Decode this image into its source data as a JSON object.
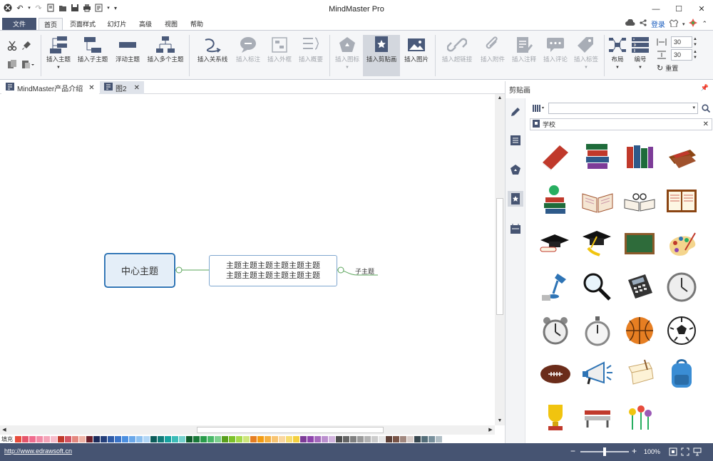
{
  "window": {
    "title": "MindMaster Pro"
  },
  "titlebar": {
    "login_label": "登录"
  },
  "ribbon_tabs": {
    "file": "文件",
    "home": "首页",
    "page_style": "页面样式",
    "slides": "幻灯片",
    "advanced": "高级",
    "view": "视图",
    "help": "帮助"
  },
  "ribbon": {
    "insert_topic": "插入主题",
    "insert_subtopic": "插入子主题",
    "floating_topic": "浮动主题",
    "insert_multiple": "插入多个主题",
    "insert_relation": "插入关系线",
    "insert_callout": "插入标注",
    "insert_boundary": "插入外框",
    "insert_summary": "插入概要",
    "insert_icon": "插入图标",
    "insert_clipart": "插入剪贴画",
    "insert_picture": "插入图片",
    "insert_hyperlink": "插入超链接",
    "insert_attachment": "插入附件",
    "insert_note": "插入注释",
    "insert_comment": "插入评论",
    "insert_tag": "插入标签",
    "layout": "布局",
    "numbering": "编号",
    "spacing_h": "30",
    "spacing_v": "30",
    "reset": "重置"
  },
  "doc_tabs": [
    {
      "label": "MindMaster产品介绍"
    },
    {
      "label": "图2"
    }
  ],
  "canvas": {
    "central_topic": "中心主题",
    "main_topic_line1": "主题主题主题主题主题主题",
    "main_topic_line2": "主题主题主题主题主题主题",
    "subtopic": "子主题"
  },
  "right_panel": {
    "title": "剪贴画",
    "category": "学校",
    "search_placeholder": ""
  },
  "clipart_items": [
    "red-book",
    "book-stack",
    "books-upright",
    "book-on-stand",
    "globe-on-books",
    "open-book",
    "open-book-glasses",
    "open-notebook",
    "graduation-cap-diploma",
    "graduation-cap-tassel",
    "chalkboard",
    "paint-palette",
    "desk-lamp",
    "magnifying-glass",
    "calculator",
    "wall-clock",
    "alarm-clock",
    "stopwatch",
    "basketball",
    "soccer-ball",
    "american-football",
    "megaphone",
    "diploma-scroll",
    "backpack",
    "trophy",
    "bench",
    "flowers"
  ],
  "statusbar": {
    "url": "http://www.edrawsoft.cn",
    "zoom_level": 100,
    "zoom_label": "100%"
  },
  "palette": {
    "fill_label": "填充"
  },
  "colors": {
    "accent": "#465472",
    "topic_border": "#2e74b5",
    "topic_fill": "#e4eef8",
    "connector": "#5aa45a"
  }
}
